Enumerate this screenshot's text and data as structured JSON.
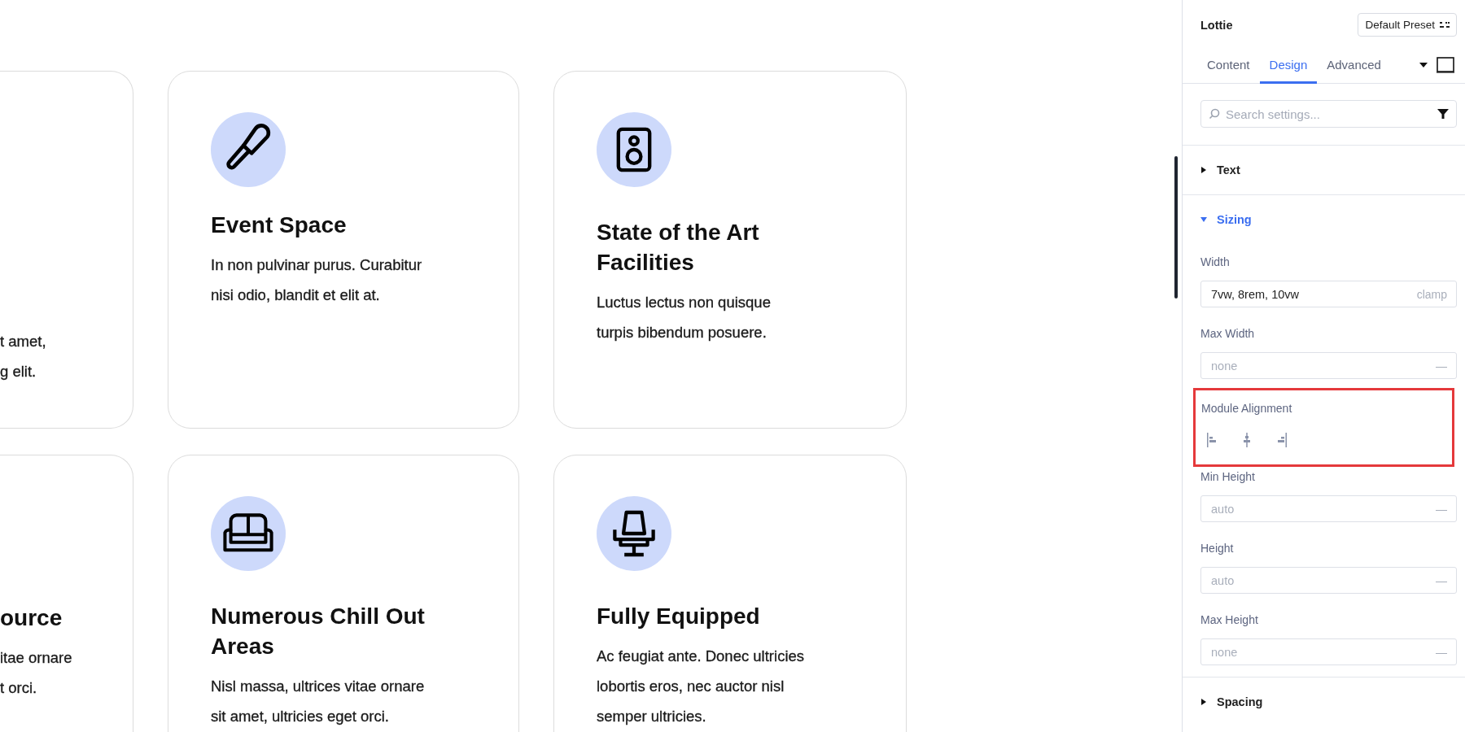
{
  "cards": [
    {
      "kind": "partial",
      "lines": [
        "t amet,",
        "g elit."
      ]
    },
    {
      "kind": "full",
      "title_lines": [
        "Event Space"
      ],
      "lines": [
        "In non pulvinar purus. Curabitur",
        "nisi odio, blandit et elit at."
      ]
    },
    {
      "kind": "full",
      "title_lines": [
        "State of the Art",
        "Facilities"
      ],
      "lines": [
        "Luctus lectus non quisque",
        "turpis bibendum posuere."
      ]
    },
    {
      "kind": "partial",
      "title_lines": [
        "ource"
      ],
      "lines": [
        "itae ornare",
        "t orci."
      ]
    },
    {
      "kind": "full",
      "title_lines": [
        "Numerous Chill Out",
        "Areas"
      ],
      "lines": [
        "Nisl massa, ultrices vitae ornare",
        "sit amet, ultricies eget orci."
      ]
    },
    {
      "kind": "full",
      "title_lines": [
        "Fully Equipped"
      ],
      "lines": [
        "Ac feugiat ante. Donec ultricies",
        "lobortis eros, nec auctor nisl",
        "semper ultricies."
      ]
    }
  ],
  "panel": {
    "title": "Lottie",
    "preset": "Default Preset",
    "tabs": [
      {
        "label": "Content",
        "selected": false
      },
      {
        "label": "Design",
        "selected": true
      },
      {
        "label": "Advanced",
        "selected": false
      }
    ],
    "search": {
      "placeholder": "Search settings..."
    },
    "sections": [
      {
        "label": "Text",
        "expanded": false
      },
      {
        "label": "Sizing",
        "expanded": true,
        "fields": [
          {
            "kind": "input",
            "label": "Width",
            "value": "7vw, 8rem, 10vw",
            "suffix": "clamp"
          },
          {
            "kind": "input",
            "label": "Max Width",
            "placeholder": "none",
            "suffix": "—"
          },
          {
            "kind": "alignment",
            "label": "Module Alignment",
            "highlighted": true
          },
          {
            "kind": "input",
            "label": "Min Height",
            "placeholder": "auto",
            "suffix": "—"
          },
          {
            "kind": "input",
            "label": "Height",
            "placeholder": "auto",
            "suffix": "—"
          },
          {
            "kind": "input",
            "label": "Max Height",
            "placeholder": "none",
            "suffix": "—"
          }
        ]
      },
      {
        "label": "Spacing",
        "expanded": false
      }
    ]
  }
}
